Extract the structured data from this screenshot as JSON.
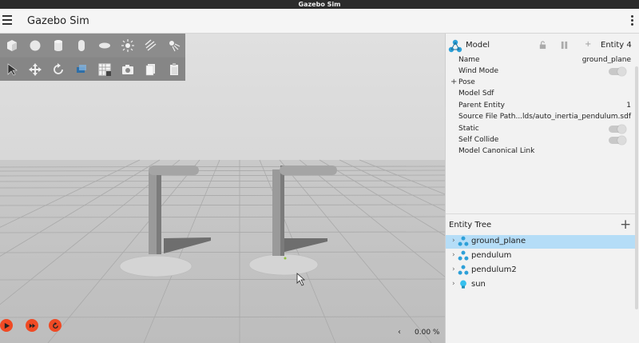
{
  "window": {
    "title": "Gazebo Sim"
  },
  "appbar": {
    "title": "Gazebo Sim"
  },
  "toolbar": {
    "row1": [
      "box-icon",
      "sphere-icon",
      "cylinder-icon",
      "capsule-icon",
      "ellipsoid-icon",
      "sun-light-icon",
      "directional-light-icon",
      "spot-light-icon"
    ],
    "row2": [
      "select-cursor-icon",
      "translate-icon",
      "rotate-icon",
      "transform-control-icon",
      "grid-icon",
      "camera-icon",
      "copy-icon",
      "paste-icon"
    ]
  },
  "status": {
    "rtf": "0.00 %",
    "rtf_arrow": "‹"
  },
  "component_inspector": {
    "title": "Model",
    "entity": "Entity 4",
    "props": {
      "name_label": "Name",
      "name_value": "ground_plane",
      "wind_label": "Wind Mode",
      "pose_expander": "+",
      "pose_label": "Pose",
      "sdf_label": "Model Sdf",
      "parent_label": "Parent Entity",
      "parent_value": "1",
      "source_label": "Source File Path",
      "source_value": "...lds/auto_inertia_pendulum.sdf",
      "static_label": "Static",
      "collide_label": "Self Collide",
      "canon_label": "Model Canonical Link"
    }
  },
  "entity_tree": {
    "title": "Entity Tree",
    "add": "+",
    "items": [
      {
        "label": "ground_plane",
        "icon": "model-icon",
        "selected": true
      },
      {
        "label": "pendulum",
        "icon": "model-icon"
      },
      {
        "label": "pendulum2",
        "icon": "model-icon"
      },
      {
        "label": "sun",
        "icon": "light-bulb-icon"
      }
    ]
  },
  "colors": {
    "accent": "#f04a24",
    "selection": "#b5ddf7",
    "model_icon": "#2da0d8"
  }
}
